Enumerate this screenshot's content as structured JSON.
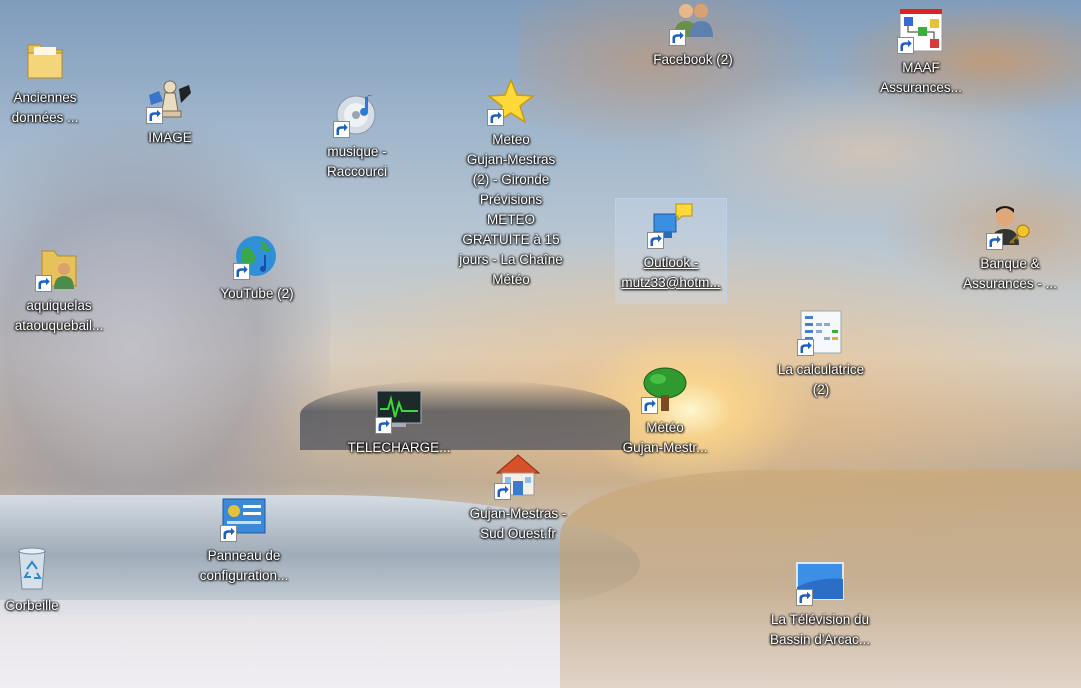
{
  "desktop": {
    "icons": [
      {
        "id": "anciennes",
        "label": "Anciennes\ndonnées ...",
        "icon": "folder-icon",
        "shortcut": false
      },
      {
        "id": "image",
        "label": "IMAGE",
        "icon": "chess-pawn-icon",
        "shortcut": true
      },
      {
        "id": "musique",
        "label": "musique -\nRaccourci",
        "icon": "music-disc-icon",
        "shortcut": true
      },
      {
        "id": "meteo-gironde",
        "label": "Meteo\nGujan-Mestras\n(2) - Gironde\nPrévisions\nMETEO\nGRATUITE à 15\njours - La Chaîne\nMétéo",
        "icon": "star-icon",
        "shortcut": true
      },
      {
        "id": "facebook",
        "label": "Facebook (2)",
        "icon": "people-icon",
        "shortcut": true
      },
      {
        "id": "maaf",
        "label": "MAAF\nAssurances...",
        "icon": "network-diagram-icon",
        "shortcut": true
      },
      {
        "id": "aquiquelas",
        "label": "aquiquelas\nataouquebail...",
        "icon": "user-folder-icon",
        "shortcut": true
      },
      {
        "id": "youtube",
        "label": "YouTube (2)",
        "icon": "globe-music-icon",
        "shortcut": true
      },
      {
        "id": "outlook",
        "label": "Outlook -\nmutz33@hotm...",
        "icon": "outlook-icon",
        "shortcut": true,
        "selected": true
      },
      {
        "id": "banque",
        "label": "Banque &\nAssurances - ...",
        "icon": "user-key-icon",
        "shortcut": true
      },
      {
        "id": "calculatrice",
        "label": "La calculatrice\n(2)",
        "icon": "spreadsheet-icon",
        "shortcut": true
      },
      {
        "id": "telecharge",
        "label": "TELECHARGE...",
        "icon": "monitor-chart-icon",
        "shortcut": true
      },
      {
        "id": "meteo-gujan",
        "label": "Météo\nGujan-Mestr...",
        "icon": "tree-icon",
        "shortcut": true
      },
      {
        "id": "sudouest",
        "label": "Gujan-Mestras -\nSud Ouest.fr",
        "icon": "house-icon",
        "shortcut": true
      },
      {
        "id": "panneau",
        "label": "Panneau de\nconfiguration...",
        "icon": "control-panel-icon",
        "shortcut": true
      },
      {
        "id": "corbeille",
        "label": "Corbeille",
        "icon": "recycle-bin-icon",
        "shortcut": false
      },
      {
        "id": "television",
        "label": "La Télévision du\nBassin d'Arcac...",
        "icon": "tv-screen-icon",
        "shortcut": true
      }
    ]
  },
  "colors": {
    "label_text": "#ffffff",
    "selection_fill": "#cddcf0",
    "shortcut_arrow": "#1e5fbf"
  }
}
